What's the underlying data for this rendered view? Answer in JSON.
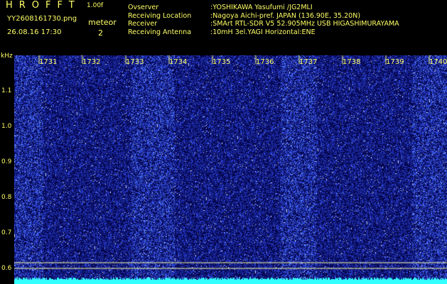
{
  "header": {
    "app_name": "HROFFT",
    "version": "1.00f",
    "filename": "YY2608161730.png",
    "timestamp": "26.08.16 17:30",
    "meteor_label": "meteor",
    "meteor_count": "2"
  },
  "info": [
    {
      "key": "Ovserver",
      "value": ":YOSHIKAWA Yasufumi /JG2MLI"
    },
    {
      "key": "Receiving Location",
      "value": ":Nagoya Aichi-pref. JAPAN (136.90E, 35.20N)"
    },
    {
      "key": "Receiver",
      "value": ":SMArt RTL-SDR V5 52.905MHz USB HIGASHIMURAYAMA"
    },
    {
      "key": "Receiving Antenna",
      "value": ":10mH 3el.YAGI Horizontal:ENE"
    }
  ],
  "axis": {
    "y_unit": "kHz",
    "y_ticks": [
      "1.1",
      "1.0",
      "0.9",
      "0.8",
      "0.7",
      "0.6"
    ],
    "x_ticks": [
      "1731",
      "1732",
      "1733",
      "1734",
      "1735",
      "1736",
      "1737",
      "1738",
      "1739",
      "1740"
    ]
  },
  "colors": {
    "text": "#ffff66",
    "noise": "#1a2bd6",
    "baseline": "#33ffff"
  }
}
